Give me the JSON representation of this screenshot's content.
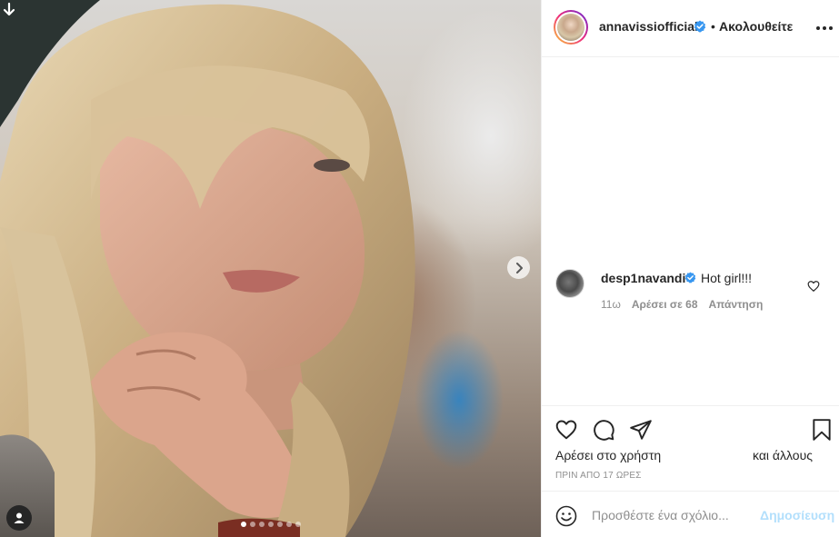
{
  "header": {
    "username": "annavissiofficial",
    "separator": "•",
    "follow_label": "Ακολουθείτε",
    "avatar_icon": "profile-avatar",
    "verified_icon": "verified-badge-icon",
    "more_icon": "more-options-icon"
  },
  "media": {
    "download_icon": "download-arrow-icon",
    "user_tag_icon": "user-tag-icon",
    "next_icon": "chevron-right-icon",
    "carousel_count": 7,
    "carousel_active_index": 0
  },
  "comment": {
    "username": "desp1navandi",
    "text": "Hot girl!!!",
    "age": "11ω",
    "likes": "Αρέσει σε 68",
    "reply": "Απάντηση",
    "like_icon": "heart-outline-icon"
  },
  "actions": {
    "like_icon": "heart-outline-icon",
    "comment_icon": "comment-bubble-icon",
    "share_icon": "paper-plane-icon",
    "save_icon": "bookmark-icon",
    "liked_by": "Αρέσει στο χρήστη",
    "and_others": "και άλλους",
    "timestamp": "ΠΡΙΝ ΑΠΟ 17 ΩΡΕΣ"
  },
  "add_comment": {
    "emoji_icon": "emoji-smile-icon",
    "placeholder": "Προσθέστε ένα σχόλιο...",
    "post_label": "Δημοσίευση"
  },
  "colors": {
    "text": "#262626",
    "muted": "#8e8e8e",
    "verified": "#3897f0",
    "post_disabled": "#b2dffc",
    "border": "#efefef"
  }
}
